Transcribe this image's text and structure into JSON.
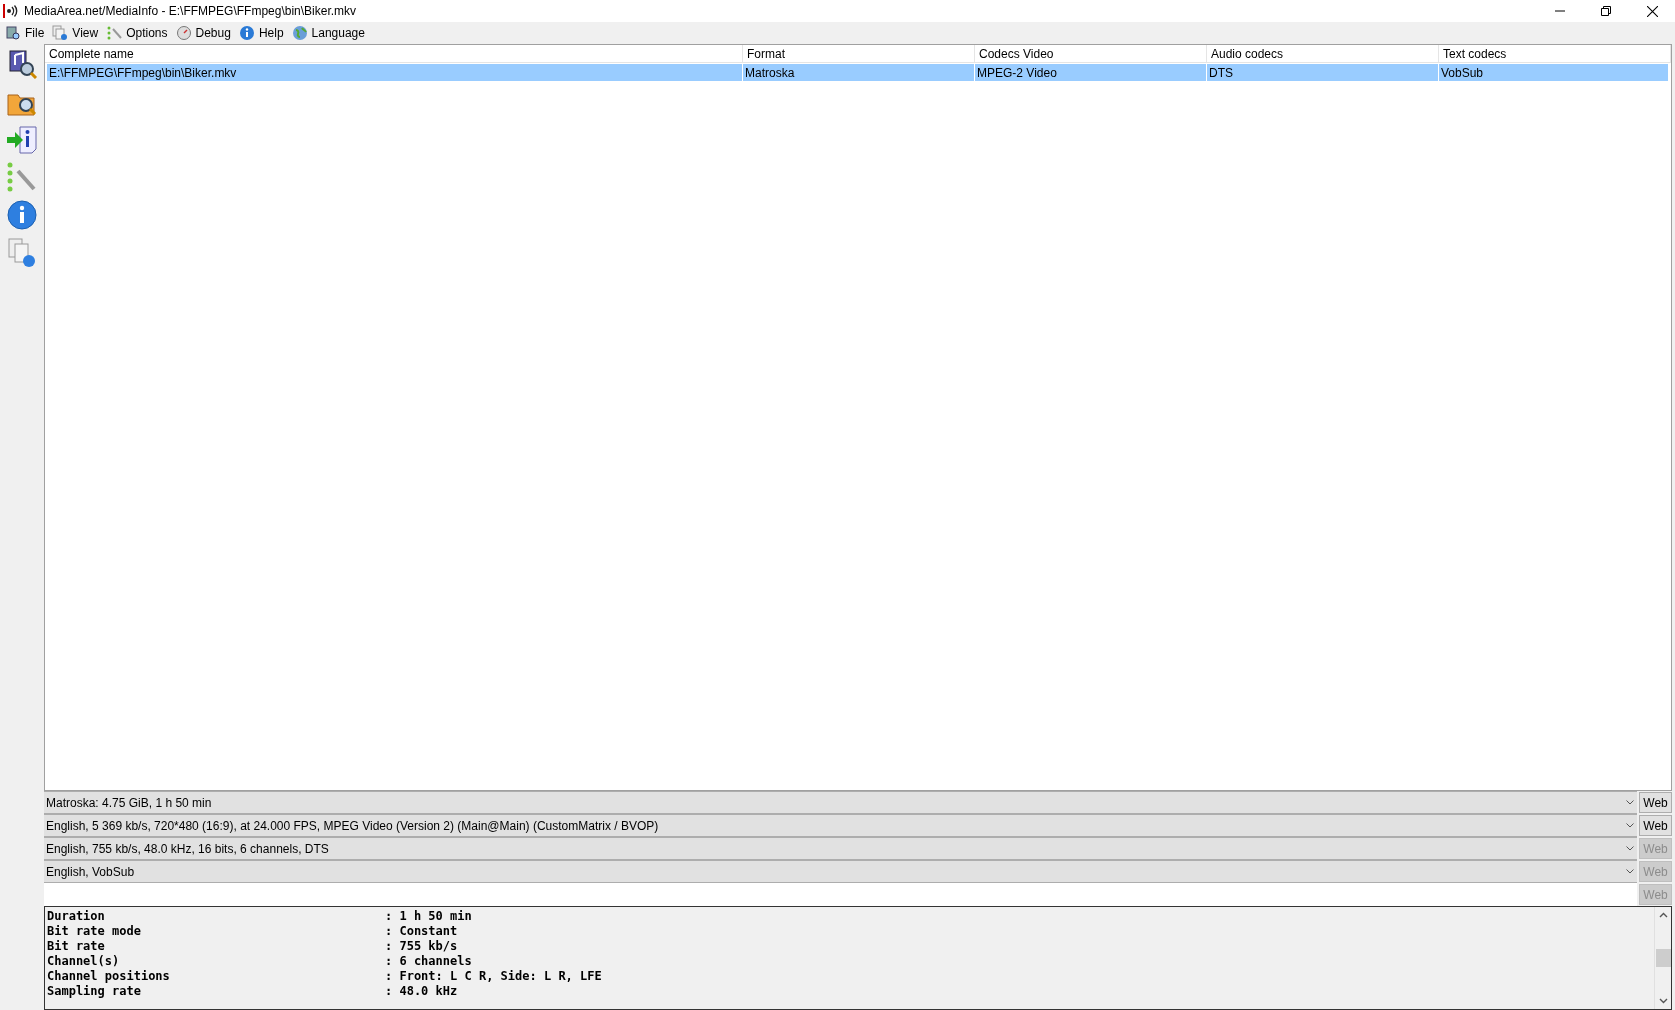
{
  "window": {
    "title": "MediaArea.net/MediaInfo - E:\\FFMPEG\\FFmpeg\\bin\\Biker.mkv"
  },
  "menu": [
    "File",
    "View",
    "Options",
    "Debug",
    "Help",
    "Language"
  ],
  "table": {
    "columns": [
      "Complete name",
      "Format",
      "Codecs Video",
      "Audio codecs",
      "Text codecs"
    ],
    "rows": [
      {
        "selected": true,
        "cells": [
          "E:\\FFMPEG\\FFmpeg\\bin\\Biker.mkv",
          "Matroska",
          "MPEG-2 Video",
          "DTS",
          "VobSub"
        ]
      }
    ]
  },
  "streams": [
    {
      "value": "Matroska: 4.75 GiB, 1 h 50 min",
      "button": "Web",
      "disabled": false
    },
    {
      "value": "English, 5 369 kb/s, 720*480 (16:9), at 24.000 FPS, MPEG Video (Version 2) (Main@Main) (CustomMatrix / BVOP)",
      "button": "Web",
      "disabled": false
    },
    {
      "value": "English, 755 kb/s, 48.0 kHz, 16 bits, 6 channels, DTS",
      "button": "Web",
      "disabled": true
    },
    {
      "value": "English, VobSub",
      "button": "Web",
      "disabled": true
    },
    {
      "button": "Web",
      "disabled": true
    }
  ],
  "details": [
    {
      "label": "Duration",
      "value": ": 1 h 50 min"
    },
    {
      "label": "Bit rate mode",
      "value": ": Constant"
    },
    {
      "label": "Bit rate",
      "value": ": 755 kb/s"
    },
    {
      "label": "Channel(s)",
      "value": ": 6 channels"
    },
    {
      "label": "Channel positions",
      "value": ": Front: L C R, Side: L R, LFE"
    },
    {
      "label": "Sampling rate",
      "value": ": 48.0 kHz"
    }
  ]
}
